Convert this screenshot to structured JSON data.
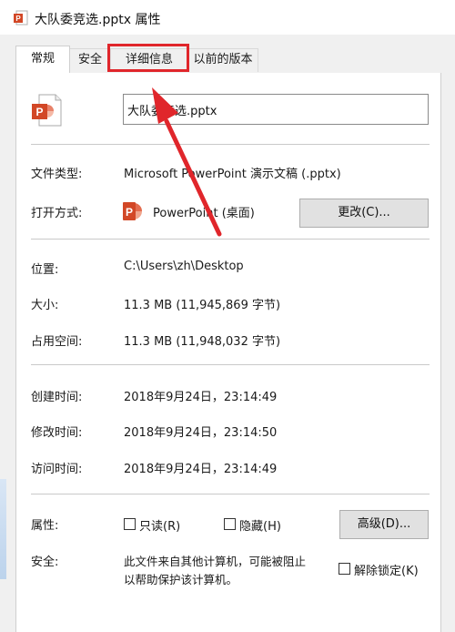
{
  "window": {
    "title": "大队委竞选.pptx 属性"
  },
  "tabs": [
    {
      "label": "常规"
    },
    {
      "label": "安全"
    },
    {
      "label": "详细信息"
    },
    {
      "label": "以前的版本"
    }
  ],
  "general": {
    "filename": "大队委竞选.pptx",
    "file_type_label": "文件类型:",
    "file_type_value": "Microsoft PowerPoint 演示文稿 (.pptx)",
    "opens_with_label": "打开方式:",
    "opens_with_value": "PowerPoint (桌面)",
    "change_button": "更改(C)...",
    "location_label": "位置:",
    "location_value": "C:\\Users\\zh\\Desktop",
    "size_label": "大小:",
    "size_value": "11.3 MB (11,945,869 字节)",
    "size_on_disk_label": "占用空间:",
    "size_on_disk_value": "11.3 MB (11,948,032 字节)",
    "created_label": "创建时间:",
    "created_value": "2018年9月24日，23:14:49",
    "modified_label": "修改时间:",
    "modified_value": "2018年9月24日，23:14:50",
    "accessed_label": "访问时间:",
    "accessed_value": "2018年9月24日，23:14:49",
    "attributes_label": "属性:",
    "readonly_label": "只读(R)",
    "hidden_label": "隐藏(H)",
    "advanced_button": "高级(D)...",
    "security_label": "安全:",
    "security_line1": "此文件来自其他计算机，可能被阻止",
    "security_line2": "以帮助保护该计算机。",
    "unblock_label": "解除锁定(K)"
  },
  "icons": {
    "app": "powerpoint-icon",
    "file": "pptx-file-icon",
    "opener": "powerpoint-icon"
  },
  "colors": {
    "annotation_red": "#e0262b",
    "powerpoint_orange": "#d24726"
  }
}
